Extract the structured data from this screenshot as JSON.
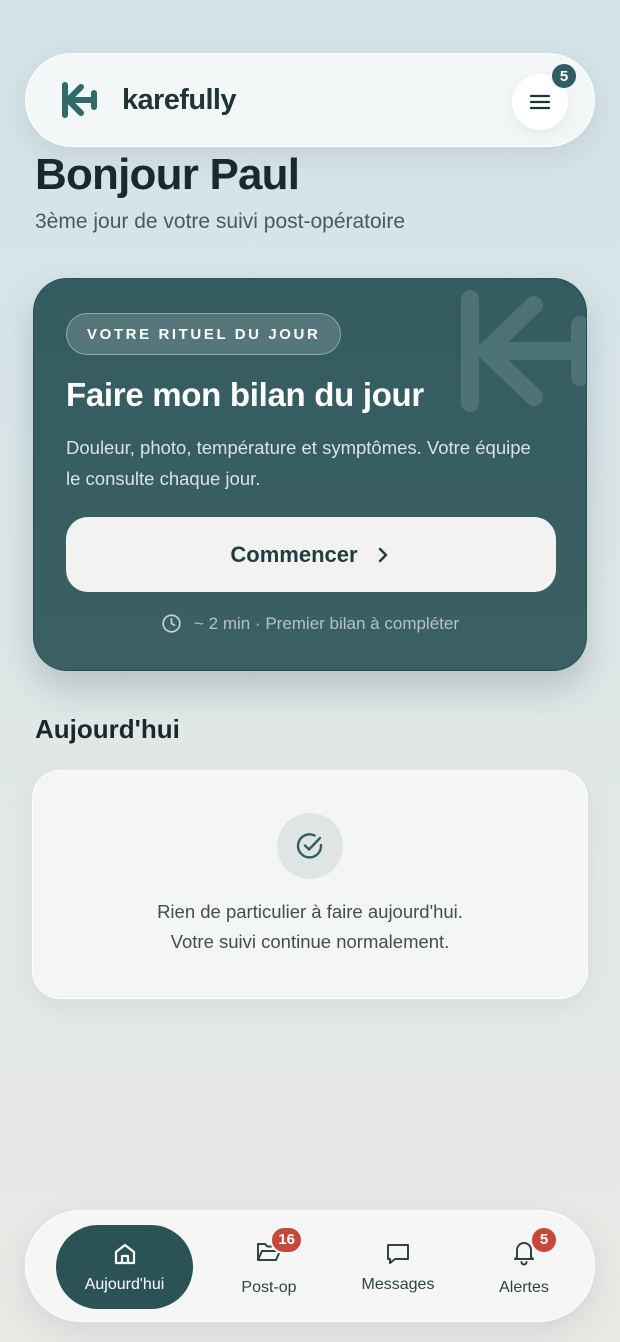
{
  "app": {
    "brand": "karefully",
    "menu_badge": "5"
  },
  "greeting": {
    "title": "Bonjour Paul",
    "subtitle": "3ème jour de votre suivi post-opératoire"
  },
  "ritual": {
    "pill": "VOTRE RITUEL DU JOUR",
    "title": "Faire mon bilan du jour",
    "description": "Douleur, photo, température et symptômes. Votre équipe le consulte chaque jour.",
    "button_label": "Commencer",
    "meta": "~ 2 min · Premier bilan à compléter"
  },
  "today": {
    "section_title": "Aujourd'hui",
    "empty_line1": "Rien de particulier à faire aujourd'hui.",
    "empty_line2": "Votre suivi continue normalement."
  },
  "nav": {
    "items": [
      {
        "label": "Aujourd'hui",
        "icon": "home-icon",
        "active": true
      },
      {
        "label": "Post-op",
        "icon": "folder-open-icon",
        "badge": "16"
      },
      {
        "label": "Messages",
        "icon": "message-icon"
      },
      {
        "label": "Alertes",
        "icon": "bell-icon",
        "badge": "5"
      }
    ]
  },
  "colors": {
    "primary": "#2b5357",
    "card": "#335c61",
    "badge_alert": "#c4493b",
    "badge_menu": "#2f5e63"
  }
}
